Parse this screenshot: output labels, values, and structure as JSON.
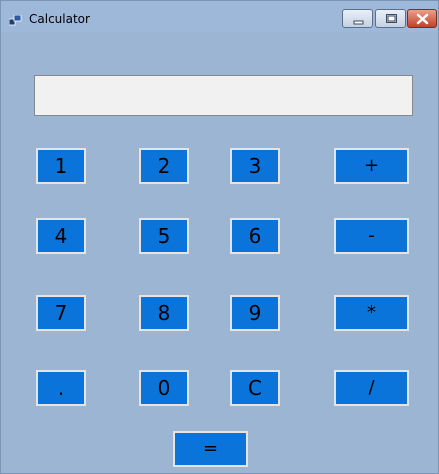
{
  "window": {
    "title": "Calculator"
  },
  "display": {
    "value": ""
  },
  "buttons": {
    "b1": "1",
    "b2": "2",
    "b3": "3",
    "plus": "+",
    "b4": "4",
    "b5": "5",
    "b6": "6",
    "minus": "-",
    "b7": "7",
    "b8": "8",
    "b9": "9",
    "multiply": "*",
    "dot": ".",
    "b0": "0",
    "clear": "C",
    "divide": "/",
    "equals": "="
  },
  "colors": {
    "button_bg": "#0a74da",
    "form_bg": "#9cb5d3",
    "display_bg": "#f1f1f1"
  },
  "icons": {
    "app": "window-app-icon",
    "minimize": "minimize-icon",
    "maximize": "maximize-icon",
    "close": "close-icon"
  }
}
